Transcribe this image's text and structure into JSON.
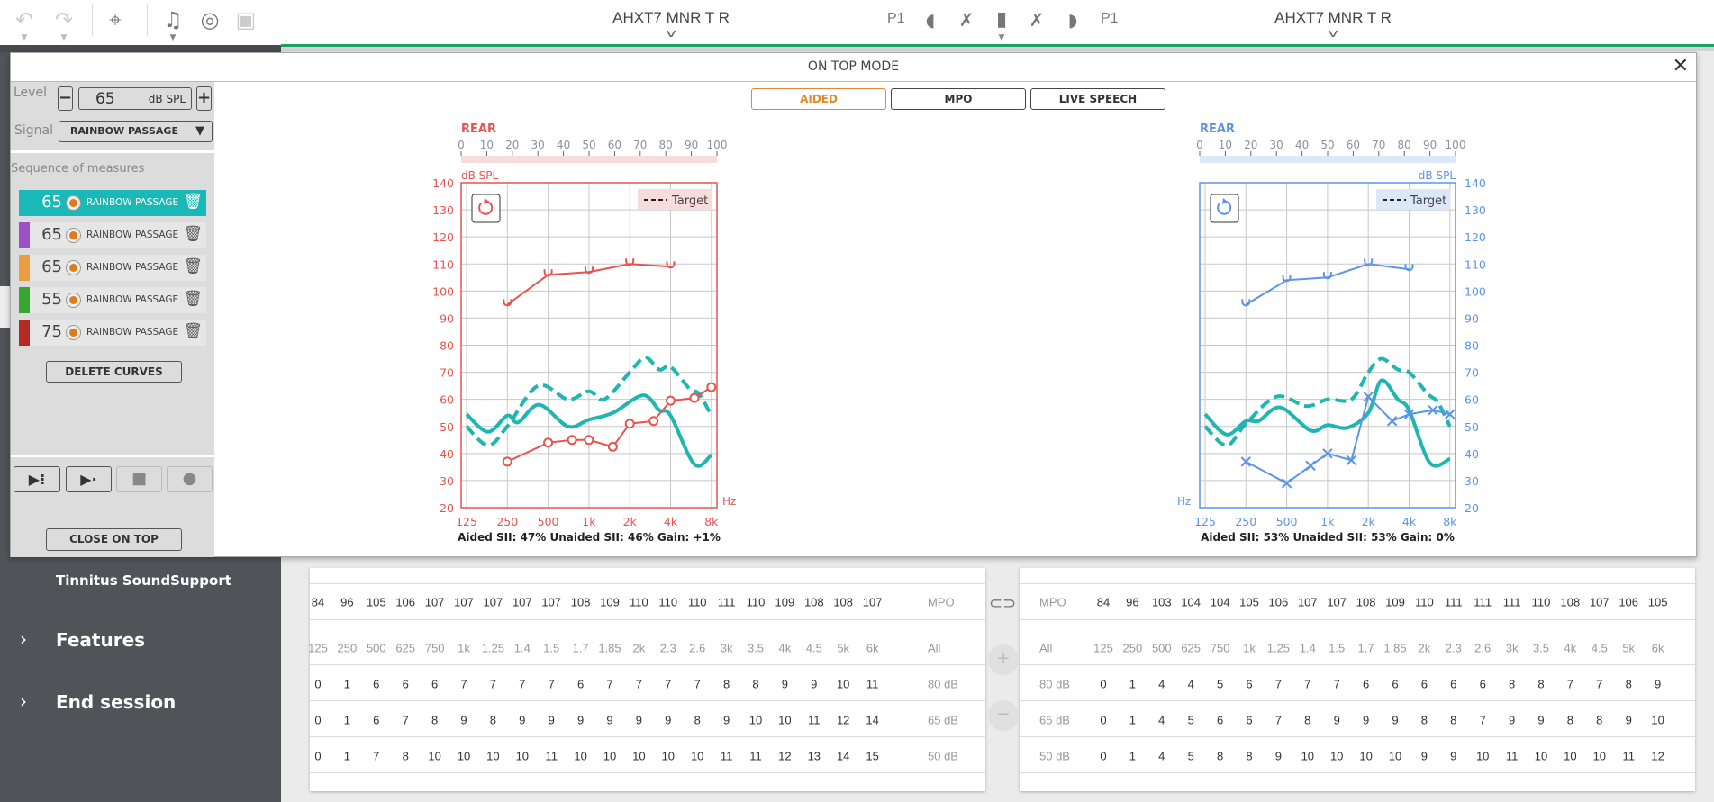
{
  "topbar": {
    "icons": [
      "undo-icon",
      "redo-icon",
      "crosshair-icon",
      "music-note-icon",
      "hearing-rings-icon",
      "video-contact-icon"
    ],
    "left_device": "AHXT7 MNR T R",
    "right_device": "AHXT7 MNR T R",
    "program_left": "P1",
    "program_right": "P1"
  },
  "sidebar": {
    "items": [
      {
        "label": "Tinnitus SoundSupport"
      },
      {
        "label": "Features"
      },
      {
        "label": "End session"
      }
    ]
  },
  "modal": {
    "title": "ON TOP MODE",
    "tabs": [
      {
        "label": "AIDED",
        "active": true
      },
      {
        "label": "MPO",
        "active": false
      },
      {
        "label": "LIVE SPEECH",
        "active": false
      }
    ],
    "left_panel": {
      "level_label": "Level",
      "level_value": "65",
      "level_unit": "dB SPL",
      "signal_label": "Signal",
      "signal_value": "RAINBOW PASSAGE",
      "sequence_title": "Sequence of measures",
      "measures": [
        {
          "level": "65",
          "signal": "RAINBOW PASSAGE",
          "color": "#1bb8b8",
          "selected": true
        },
        {
          "level": "65",
          "signal": "RAINBOW PASSAGE",
          "color": "#9b4fc9",
          "selected": false
        },
        {
          "level": "65",
          "signal": "RAINBOW PASSAGE",
          "color": "#e99c40",
          "selected": false
        },
        {
          "level": "55",
          "signal": "RAINBOW PASSAGE",
          "color": "#35a832",
          "selected": false
        },
        {
          "level": "75",
          "signal": "RAINBOW PASSAGE",
          "color": "#b52a22",
          "selected": false
        }
      ],
      "delete_curves": "DELETE CURVES",
      "close_on_top": "CLOSE ON TOP"
    }
  },
  "chart_data": [
    {
      "type": "line",
      "side": "left",
      "color": "#e8534f",
      "band_color": "#f8dcdc",
      "scale_title": "REAR",
      "scale_ticks": [
        "0",
        "10",
        "20",
        "30",
        "40",
        "50",
        "60",
        "70",
        "80",
        "90",
        "100"
      ],
      "ylabel": "dB SPL",
      "xlabel": "Hz",
      "ylim": [
        20,
        140
      ],
      "yticks": [
        "20",
        "30",
        "40",
        "50",
        "60",
        "70",
        "80",
        "90",
        "100",
        "110",
        "120",
        "130",
        "140"
      ],
      "xticks": [
        {
          "f": 125,
          "label": "125"
        },
        {
          "f": 250,
          "label": "250"
        },
        {
          "f": 500,
          "label": "500"
        },
        {
          "f": 1000,
          "label": "1k"
        },
        {
          "f": 2000,
          "label": "2k"
        },
        {
          "f": 4000,
          "label": "4k"
        },
        {
          "f": 8000,
          "label": "8k"
        }
      ],
      "legend": "Target",
      "grid": true,
      "series": {
        "mpo": [
          [
            250,
            95
          ],
          [
            500,
            106
          ],
          [
            1000,
            107
          ],
          [
            2000,
            110
          ],
          [
            4000,
            109
          ]
        ],
        "unaided": [
          [
            250,
            37
          ],
          [
            500,
            44
          ],
          [
            750,
            45
          ],
          [
            1000,
            45
          ],
          [
            1500,
            42.5
          ],
          [
            2000,
            51
          ],
          [
            3000,
            52
          ],
          [
            4000,
            59.5
          ],
          [
            6000,
            60.5
          ],
          [
            8000,
            64.5
          ]
        ],
        "aided": [
          [
            125,
            54.5
          ],
          [
            180,
            48
          ],
          [
            250,
            54
          ],
          [
            300,
            51.5
          ],
          [
            430,
            58
          ],
          [
            700,
            50
          ],
          [
            1000,
            52.5
          ],
          [
            1500,
            55
          ],
          [
            2500,
            61.5
          ],
          [
            3300,
            56
          ],
          [
            4000,
            54
          ],
          [
            6000,
            36
          ],
          [
            8000,
            39.5
          ]
        ],
        "target": [
          [
            125,
            50
          ],
          [
            180,
            43
          ],
          [
            250,
            50
          ],
          [
            420,
            65
          ],
          [
            700,
            60
          ],
          [
            1000,
            63
          ],
          [
            1300,
            60
          ],
          [
            2000,
            70
          ],
          [
            2600,
            75.5
          ],
          [
            3300,
            71
          ],
          [
            4000,
            72
          ],
          [
            5500,
            64
          ],
          [
            6500,
            62
          ],
          [
            8000,
            54
          ]
        ]
      },
      "unaided_marker": "circle",
      "sii": "Aided SII: 47%   Unaided SII: 46%   Gain: +1%"
    },
    {
      "type": "line",
      "side": "right",
      "color": "#5b93e8",
      "band_color": "#dce7f8",
      "scale_title": "REAR",
      "scale_ticks": [
        "0",
        "10",
        "20",
        "30",
        "40",
        "50",
        "60",
        "70",
        "80",
        "90",
        "100"
      ],
      "ylabel": "dB SPL",
      "xlabel": "Hz",
      "ylim": [
        20,
        140
      ],
      "yticks": [
        "20",
        "30",
        "40",
        "50",
        "60",
        "70",
        "80",
        "90",
        "100",
        "110",
        "120",
        "130",
        "140"
      ],
      "xticks": [
        {
          "f": 125,
          "label": "125"
        },
        {
          "f": 250,
          "label": "250"
        },
        {
          "f": 500,
          "label": "500"
        },
        {
          "f": 1000,
          "label": "1k"
        },
        {
          "f": 2000,
          "label": "2k"
        },
        {
          "f": 4000,
          "label": "4k"
        },
        {
          "f": 8000,
          "label": "8k"
        }
      ],
      "legend": "Target",
      "grid": true,
      "series": {
        "mpo": [
          [
            250,
            95
          ],
          [
            500,
            104
          ],
          [
            1000,
            105
          ],
          [
            2000,
            110
          ],
          [
            4000,
            108
          ]
        ],
        "unaided": [
          [
            250,
            37
          ],
          [
            500,
            29
          ],
          [
            750,
            35.5
          ],
          [
            1000,
            40
          ],
          [
            1500,
            37.5
          ],
          [
            2000,
            61
          ],
          [
            3000,
            52
          ],
          [
            4000,
            54.5
          ],
          [
            6000,
            56
          ],
          [
            8000,
            54.5
          ]
        ],
        "aided": [
          [
            125,
            54.5
          ],
          [
            180,
            47
          ],
          [
            250,
            52
          ],
          [
            310,
            52
          ],
          [
            450,
            57
          ],
          [
            750,
            48.5
          ],
          [
            1000,
            50.5
          ],
          [
            1400,
            49.5
          ],
          [
            2000,
            55
          ],
          [
            2500,
            67
          ],
          [
            3300,
            60
          ],
          [
            4000,
            56
          ],
          [
            5700,
            36.5
          ],
          [
            8000,
            38
          ]
        ],
        "target": [
          [
            125,
            50
          ],
          [
            180,
            43
          ],
          [
            250,
            51
          ],
          [
            420,
            61
          ],
          [
            700,
            57.5
          ],
          [
            1000,
            60
          ],
          [
            1500,
            60
          ],
          [
            2000,
            70
          ],
          [
            2500,
            75
          ],
          [
            3300,
            71
          ],
          [
            4000,
            70
          ],
          [
            5500,
            62
          ],
          [
            6500,
            59
          ],
          [
            8000,
            50
          ]
        ]
      },
      "unaided_marker": "x",
      "sii": "Aided SII: 53%   Unaided SII: 53%   Gain: 0%"
    }
  ],
  "tables": {
    "left": {
      "mpo_label": "MPO",
      "mpo": [
        "84",
        "96",
        "105",
        "106",
        "107",
        "107",
        "107",
        "107",
        "107",
        "108",
        "109",
        "110",
        "110",
        "110",
        "111",
        "110",
        "109",
        "108",
        "108",
        "107"
      ],
      "freqs": [
        "125",
        "250",
        "500",
        "625",
        "750",
        "1k",
        "1.25",
        "1.4",
        "1.5",
        "1.7",
        "1.85",
        "2k",
        "2.3",
        "2.6",
        "3k",
        "3.5",
        "4k",
        "4.5",
        "5k",
        "6k"
      ],
      "all_label": "All",
      "rows": [
        {
          "label": "80 dB",
          "values": [
            "0",
            "1",
            "6",
            "6",
            "6",
            "7",
            "7",
            "7",
            "7",
            "6",
            "7",
            "7",
            "7",
            "7",
            "8",
            "8",
            "9",
            "9",
            "10",
            "11"
          ]
        },
        {
          "label": "65 dB",
          "values": [
            "0",
            "1",
            "6",
            "7",
            "8",
            "9",
            "8",
            "9",
            "9",
            "9",
            "9",
            "9",
            "9",
            "8",
            "9",
            "10",
            "10",
            "11",
            "12",
            "14"
          ]
        },
        {
          "label": "50 dB",
          "values": [
            "0",
            "1",
            "7",
            "8",
            "10",
            "10",
            "10",
            "10",
            "11",
            "10",
            "10",
            "10",
            "10",
            "10",
            "11",
            "11",
            "12",
            "13",
            "14",
            "15"
          ]
        }
      ]
    },
    "right": {
      "mpo_label": "MPO",
      "mpo": [
        "84",
        "96",
        "103",
        "104",
        "104",
        "105",
        "106",
        "107",
        "107",
        "108",
        "109",
        "110",
        "111",
        "111",
        "111",
        "110",
        "108",
        "107",
        "106",
        "105"
      ],
      "freqs": [
        "125",
        "250",
        "500",
        "625",
        "750",
        "1k",
        "1.25",
        "1.4",
        "1.5",
        "1.7",
        "1.85",
        "2k",
        "2.3",
        "2.6",
        "3k",
        "3.5",
        "4k",
        "4.5",
        "5k",
        "6k"
      ],
      "all_label": "All",
      "rows": [
        {
          "label": "80 dB",
          "values": [
            "0",
            "1",
            "4",
            "4",
            "5",
            "6",
            "7",
            "7",
            "7",
            "6",
            "6",
            "6",
            "6",
            "6",
            "8",
            "8",
            "7",
            "7",
            "8",
            "9"
          ]
        },
        {
          "label": "65 dB",
          "values": [
            "0",
            "1",
            "4",
            "5",
            "6",
            "6",
            "7",
            "8",
            "9",
            "9",
            "9",
            "8",
            "8",
            "7",
            "9",
            "9",
            "8",
            "8",
            "9",
            "10"
          ]
        },
        {
          "label": "50 dB",
          "values": [
            "0",
            "1",
            "4",
            "5",
            "8",
            "8",
            "9",
            "10",
            "10",
            "10",
            "10",
            "9",
            "9",
            "10",
            "11",
            "10",
            "10",
            "10",
            "11",
            "12"
          ]
        }
      ]
    }
  }
}
